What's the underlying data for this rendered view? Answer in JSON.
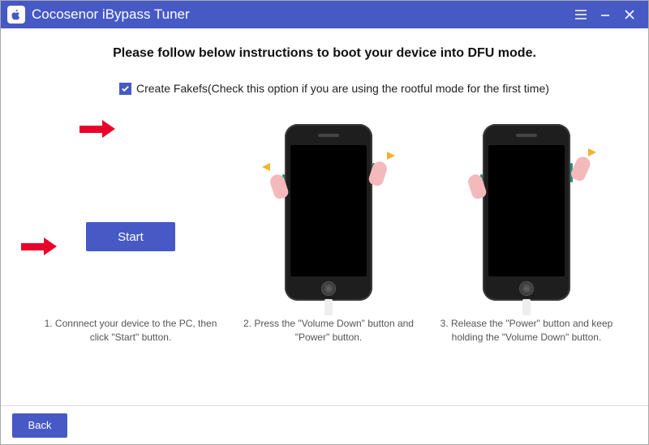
{
  "titlebar": {
    "title": "Cocosenor iBypass Tuner"
  },
  "headline": "Please follow below instructions to boot your device into DFU mode.",
  "option": {
    "checked": true,
    "label": "Create Fakefs(Check this option if you are using the rootful mode for the first time)"
  },
  "start_label": "Start",
  "captions": {
    "c1": "1. Connnect your device to the PC, then click \"Start\" button.",
    "c2": "2. Press the \"Volume Down\" button and \"Power\" button.",
    "c3": "3. Release the \"Power\" button and keep holding the \"Volume Down\" button."
  },
  "footer": {
    "back_label": "Back"
  },
  "colors": {
    "primary": "#4659c4",
    "arrow": "#e9032b"
  }
}
